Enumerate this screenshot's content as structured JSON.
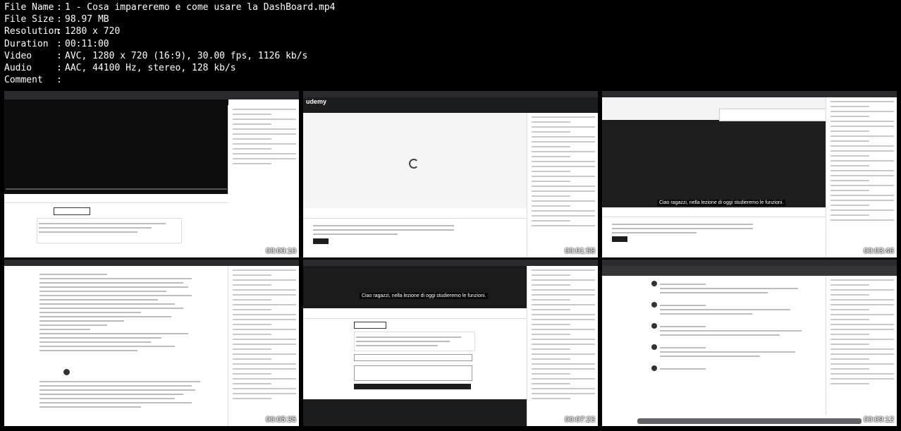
{
  "metadata": {
    "rows": [
      {
        "key": "File Name",
        "value": "1 - Cosa impareremo e come usare la DashBoard.mp4"
      },
      {
        "key": "File Size",
        "value": "98.97 MB"
      },
      {
        "key": "Resolution",
        "value": "1280 x 720"
      },
      {
        "key": "Duration",
        "value": "00:11:00"
      },
      {
        "key": "Video",
        "value": "AVC, 1280 x 720 (16:9), 30.00 fps, 1126 kb/s"
      },
      {
        "key": "Audio",
        "value": "AAC, 44100 Hz, stereo, 128 kb/s"
      },
      {
        "key": "Comment",
        "value": ""
      }
    ],
    "separator": ":"
  },
  "thumbnails": [
    {
      "timestamp": "00:00:10"
    },
    {
      "timestamp": "00:01:58",
      "brand": "udemy"
    },
    {
      "timestamp": "00:03:46",
      "caption": "Ciao ragazzi, nella lezione di oggi studieremo le funzioni."
    },
    {
      "timestamp": "00:05:35"
    },
    {
      "timestamp": "00:07:23",
      "caption": "Ciao ragazzi, nella lezione di oggi studieremo le funzioni."
    },
    {
      "timestamp": "00:09:12"
    }
  ],
  "colors": {
    "background": "#000000",
    "text": "#ffffff",
    "thumb_bg": "#ffffff",
    "dark_ui": "#1c1c1e"
  }
}
